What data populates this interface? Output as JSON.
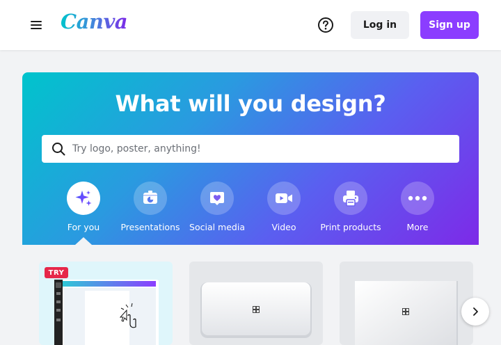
{
  "header": {
    "logo": "Canva",
    "login_label": "Log in",
    "signup_label": "Sign up"
  },
  "hero": {
    "title": "What will you design?",
    "search_placeholder": "Try logo, poster, anything!"
  },
  "categories": [
    {
      "label": "For you",
      "icon": "sparkle-icon",
      "active": true
    },
    {
      "label": "Presentations",
      "icon": "presentation-icon",
      "active": false
    },
    {
      "label": "Social media",
      "icon": "heart-icon",
      "active": false
    },
    {
      "label": "Video",
      "icon": "video-camera-icon",
      "active": false
    },
    {
      "label": "Print products",
      "icon": "printer-icon",
      "active": false
    },
    {
      "label": "More",
      "icon": "more-dots-icon",
      "active": false
    }
  ],
  "cards": {
    "badge": "TRY"
  },
  "colors": {
    "brand_purple": "#8b3dff",
    "gradient_start": "#00c4cc",
    "gradient_end": "#7d2ae8",
    "badge_red": "#e6284a"
  }
}
